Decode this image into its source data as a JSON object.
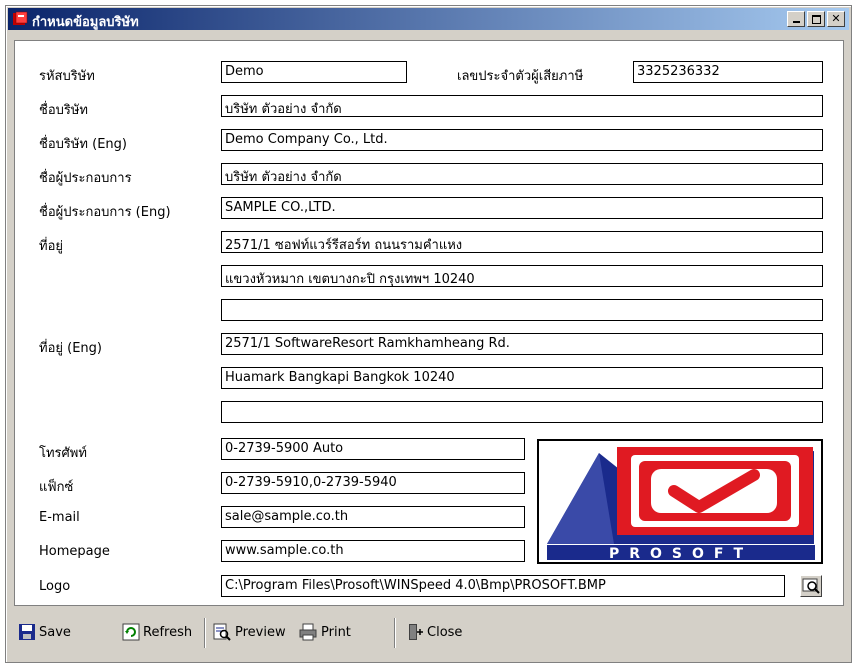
{
  "window": {
    "title": "กำหนดข้อมูลบริษัท"
  },
  "form": {
    "company_code": {
      "label": "รหัสบริษัท",
      "value": "Demo"
    },
    "tax_id": {
      "label": "เลขประจำตัวผู้เสียภาษี",
      "value": "3325236332"
    },
    "company_name": {
      "label": "ชื่อบริษัท",
      "value": "บริษัท ตัวอย่าง จำกัด"
    },
    "company_name_eng": {
      "label": "ชื่อบริษัท (Eng)",
      "value": "Demo Company Co., Ltd."
    },
    "operator_name": {
      "label": "ชื่อผู้ประกอบการ",
      "value": "บริษัท ตัวอย่าง จำกัด"
    },
    "operator_name_eng": {
      "label": "ชื่อผู้ประกอบการ (Eng)",
      "value": "SAMPLE CO.,LTD."
    },
    "address": {
      "label": "ที่อยู่",
      "line1": "2571/1 ซอฟท์แวร์รีสอร์ท ถนนรามคำแหง",
      "line2": "แขวงหัวหมาก เขตบางกะปิ กรุงเทพฯ 10240",
      "line3": ""
    },
    "address_eng": {
      "label": "ที่อยู่ (Eng)",
      "line1": "2571/1  SoftwareResort  Ramkhamheang Rd.",
      "line2": "Huamark Bangkapi Bangkok 10240",
      "line3": ""
    },
    "phone": {
      "label": "โทรศัพท์",
      "value": "0-2739-5900  Auto"
    },
    "fax": {
      "label": "แฟ็กซ์",
      "value": "0-2739-5910,0-2739-5940"
    },
    "email": {
      "label": "E-mail",
      "value": "sale@sample.co.th"
    },
    "homepage": {
      "label": "Homepage",
      "value": "www.sample.co.th"
    },
    "logo": {
      "label": "Logo",
      "value": "C:\\Program Files\\Prosoft\\WINSpeed 4.0\\Bmp\\PROSOFT.BMP",
      "brand_text": "PROSOFT"
    }
  },
  "toolbar": {
    "save": "Save",
    "refresh": "Refresh",
    "preview": "Preview",
    "print": "Print",
    "close": "Close"
  },
  "colors": {
    "titlebar": "#0a246a",
    "logo_red": "#e01a22",
    "logo_blue": "#1a2a8c"
  }
}
